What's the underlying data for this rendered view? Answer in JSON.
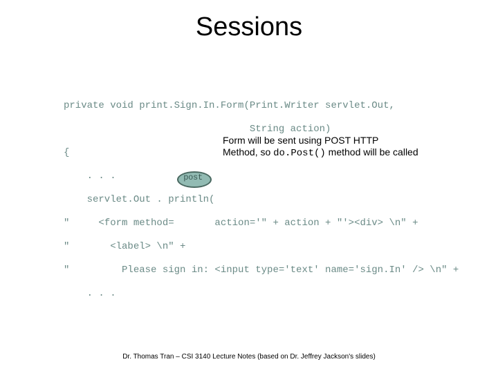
{
  "title": "Sessions",
  "code": {
    "l1": "private void print.Sign.In.Form(Print.Writer servlet.Out,",
    "l2": "                                String action)",
    "l3": "{",
    "l4": "    . . .",
    "l5": "    servlet.Out . println(",
    "l6": "\"     <form method=       action='\" + action + \"'><div> \\n\" +",
    "l7": "\"       <label> \\n\" +",
    "l8": "\"         Please sign in: <input type='text' name='sign.In' /> \\n\" +",
    "l9": "    . . ."
  },
  "highlight_word": "post",
  "callout": {
    "line1": "Form will be sent using POST HTTP",
    "line2a": "Method, so ",
    "line2_code": "do.Post()",
    "line2b": " method will be called"
  },
  "footer": "Dr. Thomas Tran – CSI 3140 Lecture Notes (based on Dr. Jeffrey Jackson's slides)"
}
